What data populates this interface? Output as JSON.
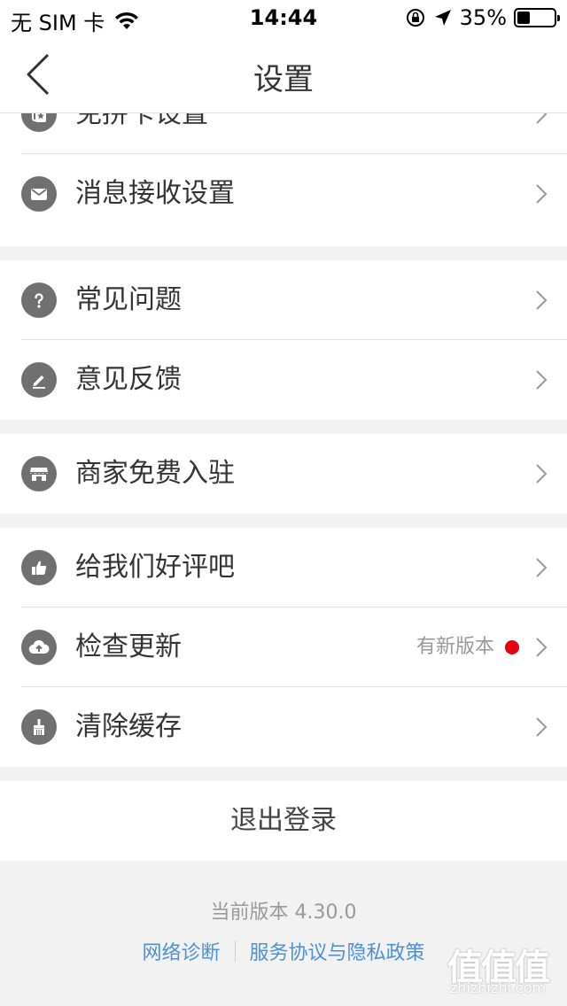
{
  "status_bar": {
    "carrier": "无 SIM 卡",
    "time": "14:44",
    "battery": "35%",
    "battery_level": 0.35
  },
  "nav": {
    "title": "设置"
  },
  "groups": [
    {
      "items": [
        {
          "label": "免拼卡设置",
          "icon": "card-star-icon"
        },
        {
          "label": "消息接收设置",
          "icon": "mail-icon"
        }
      ]
    },
    {
      "items": [
        {
          "label": "常见问题",
          "icon": "question-icon"
        },
        {
          "label": "意见反馈",
          "icon": "pencil-icon"
        }
      ]
    },
    {
      "items": [
        {
          "label": "商家免费入驻",
          "icon": "store-icon"
        }
      ]
    },
    {
      "items": [
        {
          "label": "给我们好评吧",
          "icon": "thumbs-up-icon"
        },
        {
          "label": "检查更新",
          "icon": "cloud-upload-icon",
          "badge": "有新版本"
        },
        {
          "label": "清除缓存",
          "icon": "broom-icon"
        }
      ]
    }
  ],
  "logout_label": "退出登录",
  "version_text": "当前版本 4.30.0",
  "links": {
    "diagnose": "网络诊断",
    "policy": "服务协议与隐私政策"
  },
  "watermark": {
    "glyphs": "值值值",
    "url": "zhizhizhi.com"
  },
  "colors": {
    "accent_link": "#4a90d9",
    "badge_dot": "#e60012",
    "icon_bg": "#707070"
  }
}
